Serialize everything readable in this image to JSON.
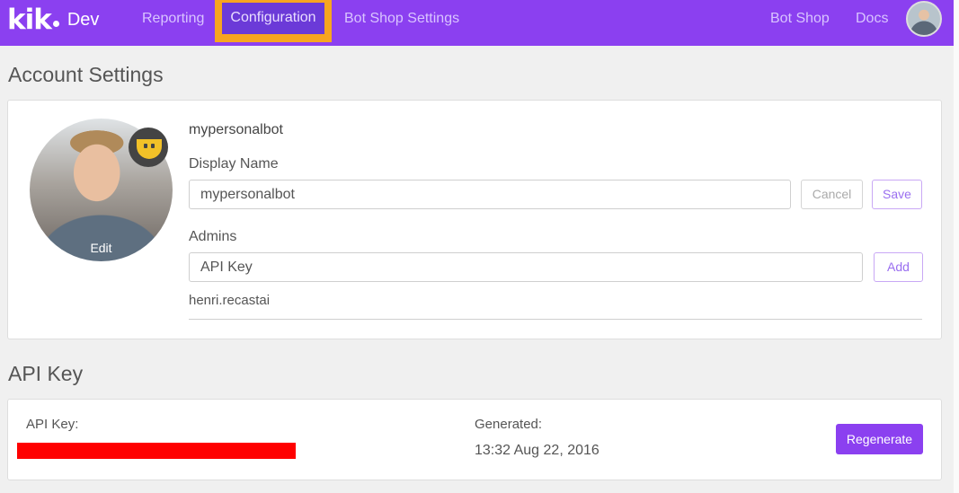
{
  "header": {
    "logo_text": "kik",
    "logo_suffix": "Dev",
    "nav": {
      "reporting": "Reporting",
      "configuration": "Configuration",
      "bot_shop_settings": "Bot Shop Settings",
      "bot_shop": "Bot Shop",
      "docs": "Docs"
    }
  },
  "account": {
    "title": "Account Settings",
    "edit_label": "Edit",
    "bot_name": "mypersonalbot",
    "display_name_label": "Display Name",
    "display_name_value": "mypersonalbot",
    "cancel_label": "Cancel",
    "save_label": "Save",
    "admins_label": "Admins",
    "admins_input_value": "API Key",
    "add_label": "Add",
    "admin_username": "henri.recastai"
  },
  "api_key": {
    "title": "API Key",
    "label": "API Key:",
    "generated_label": "Generated:",
    "generated_value": "13:32 Aug 22, 2016",
    "regenerate_label": "Regenerate"
  },
  "colors": {
    "brand_purple": "#8b40f0",
    "highlight_orange": "#f7a520",
    "redaction_red": "#ff0000"
  },
  "icons": [
    "user-avatar",
    "bot-face-icon"
  ]
}
